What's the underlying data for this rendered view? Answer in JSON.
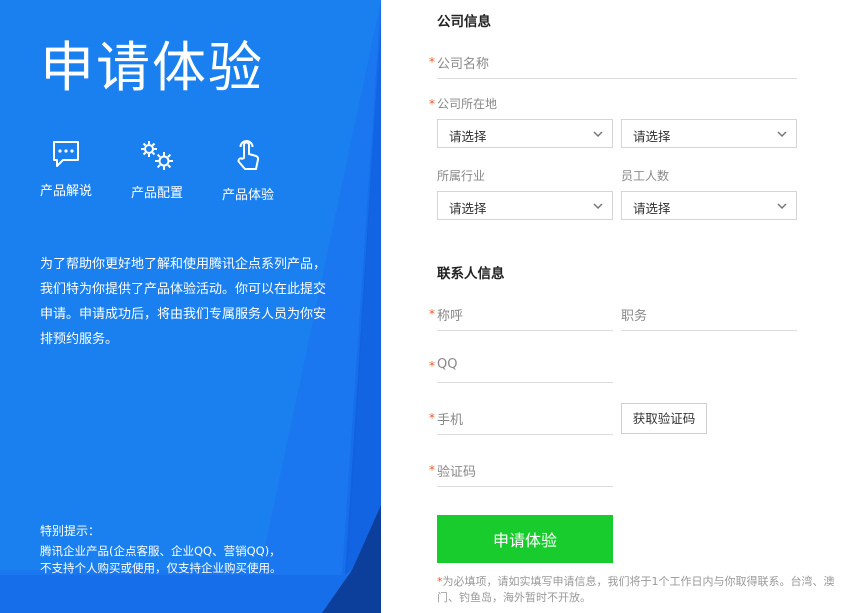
{
  "left": {
    "title": "申请体验",
    "features": [
      {
        "icon": "chat-bubble-icon",
        "label": "产品解说"
      },
      {
        "icon": "gears-icon",
        "label": "产品配置"
      },
      {
        "icon": "tap-hand-icon",
        "label": "产品体验"
      }
    ],
    "description": "为了帮助你更好地了解和使用腾讯企点系列产品，我们特为你提供了产品体验活动。你可以在此提交申请。申请成功后，将由我们专属服务人员为你安排预约服务。",
    "note_title": "特别提示：",
    "note_line1": "腾讯企业产品(企点客服、企业QQ、营销QQ)，",
    "note_line2": "不支持个人购买或使用，仅支持企业购买使用。"
  },
  "form": {
    "company_section": "公司信息",
    "company_name_label": "公司名称",
    "company_location_label": "公司所在地",
    "province_select": "请选择",
    "city_select": "请选择",
    "industry_label": "所属行业",
    "industry_select": "请选择",
    "employees_label": "员工人数",
    "employees_select": "请选择",
    "contact_section": "联系人信息",
    "salutation_label": "称呼",
    "position_label": "职务",
    "qq_label": "QQ",
    "phone_label": "手机",
    "get_code_button": "获取验证码",
    "code_label": "验证码",
    "required_mark": "*",
    "submit_button": "申请体验",
    "footnote_text": "为必填项，请如实填写申请信息，我们将于1个工作日内与你取得联系。台湾、澳门、钓鱼岛，海外暂时不开放。"
  },
  "colors": {
    "left_panel": "#1a80f0",
    "submit": "#19cc2e",
    "required": "#f05a28"
  }
}
